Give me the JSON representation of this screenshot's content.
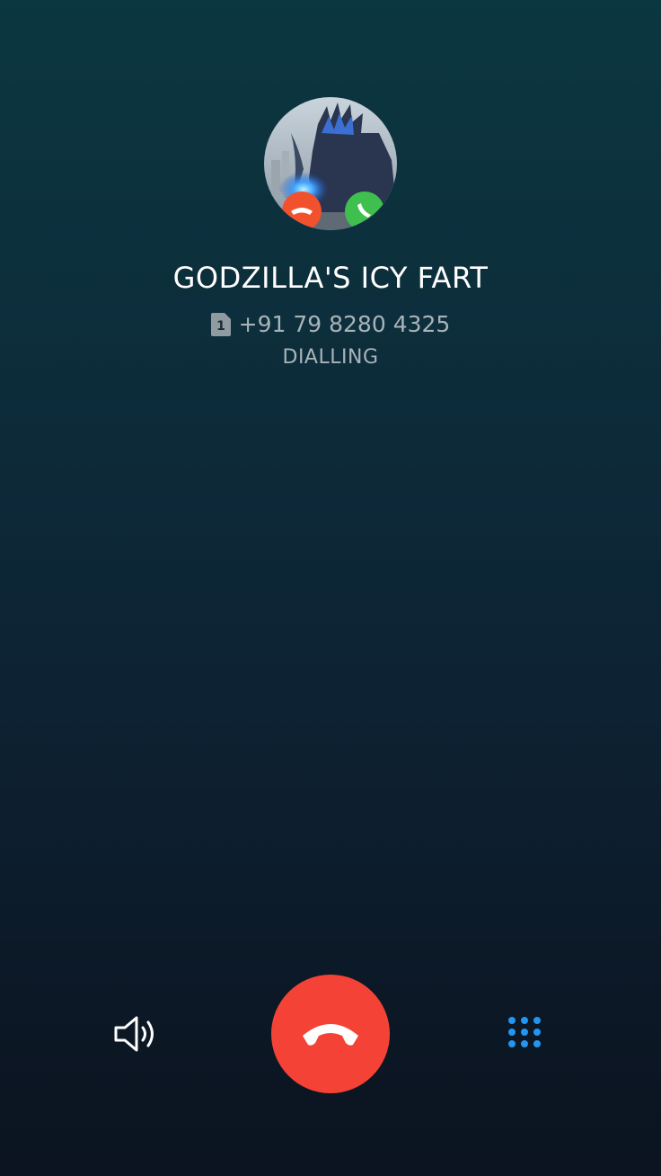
{
  "contact": {
    "name": "GODZILLA'S ICY FART",
    "sim_slot": "1",
    "number": "+91 79 8280 4325",
    "status": "DIALLING"
  },
  "controls": {
    "speaker_icon": "speaker-icon",
    "end_call_icon": "end-call-icon",
    "keypad_icon": "dialpad-icon"
  },
  "colors": {
    "end_call": "#f44336",
    "keypad_accent": "#2196f3",
    "secondary_text": "#a8b4b9"
  }
}
